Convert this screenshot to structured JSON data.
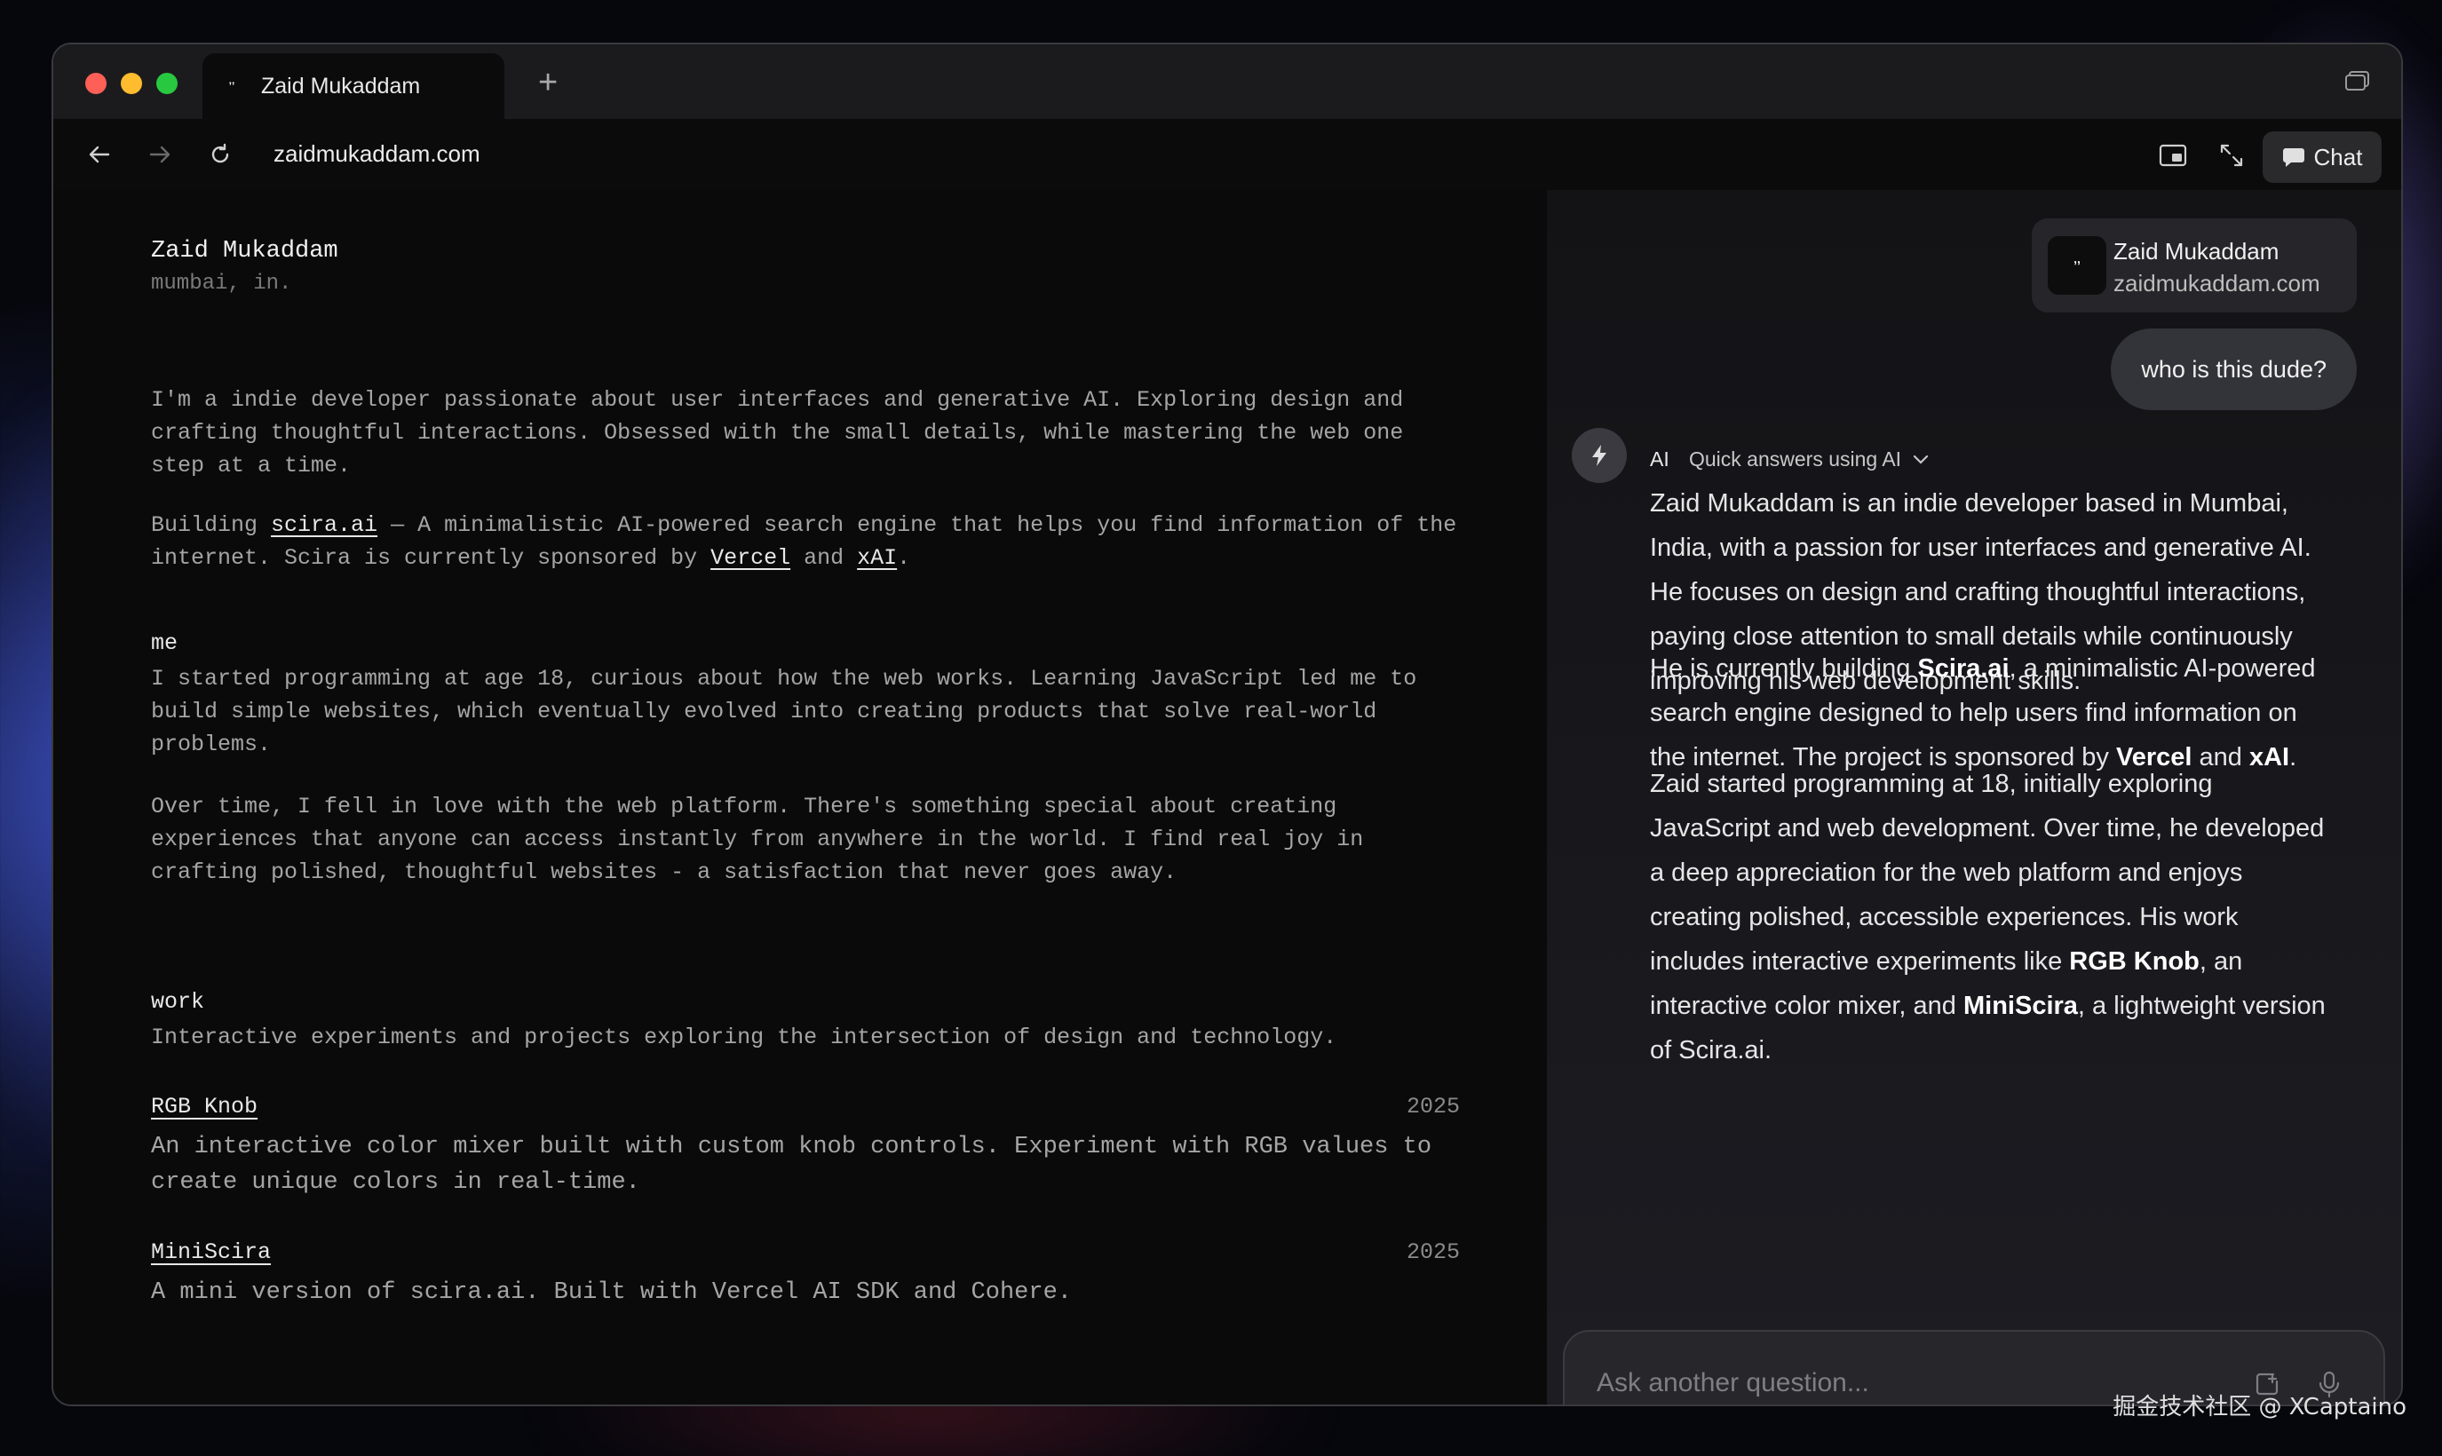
{
  "browser": {
    "tab_title": "Zaid Mukaddam",
    "favicon_text": "ʼʼ",
    "new_tab": "+",
    "url": "zaidmukaddam.com",
    "chat_label": "Chat"
  },
  "page": {
    "name": "Zaid Mukaddam",
    "location": "mumbai, in.",
    "intro": "I'm a indie developer passionate about user interfaces and generative AI. Exploring design and crafting thoughtful interactions. Obsessed with the small details, while mastering the web one step at a time.",
    "building_prefix": "Building ",
    "building_link": "scira.ai",
    "building_mid": " — A minimalistic AI-powered search engine that helps you find information of the internet. Scira is currently sponsored by ",
    "sponsor1": "Vercel",
    "and": " and ",
    "sponsor2": "xAI",
    "period": ".",
    "me_heading": "me",
    "me_p1": "I started programming at age 18, curious about how the web works. Learning JavaScript led me to build simple websites, which eventually evolved into creating products that solve real-world problems.",
    "me_p2": "Over time, I fell in love with the web platform. There's something special about creating experiences that anyone can access instantly from anywhere in the world. I find real joy in crafting polished, thoughtful websites - a satisfaction that never goes away.",
    "work_heading": "work",
    "work_desc": "Interactive experiments and projects exploring the intersection of design and technology.",
    "projects": [
      {
        "title": "RGB Knob",
        "year": "2025",
        "desc": "An interactive color mixer built with custom knob controls. Experiment with RGB values to create unique colors in real-time."
      },
      {
        "title": "MiniScira",
        "year": "2025",
        "desc": "A mini version of scira.ai. Built with Vercel AI SDK and Cohere."
      }
    ]
  },
  "chat": {
    "context_name": "Zaid Mukaddam",
    "context_url": "zaidmukaddam.com",
    "user_message": "who is this dude?",
    "ai_tag": "AI",
    "ai_mode": "Quick answers using AI",
    "answer_p1": "Zaid Mukaddam is an indie developer based in Mumbai, India, with a passion for user interfaces and generative AI. He focuses on design and crafting thoughtful interactions, paying close attention to small details while continuously improving his web development skills.",
    "answer_p2_a": "He is currently building ",
    "answer_p2_b": "Scira.ai",
    "answer_p2_c": ", a minimalistic AI-powered search engine designed to help users find information on the internet. The project is sponsored by ",
    "answer_p2_d": "Vercel",
    "answer_p2_e": " and ",
    "answer_p2_f": "xAI",
    "answer_p2_g": ".",
    "answer_p3_a": "Zaid started programming at 18, initially exploring JavaScript and web development. Over time, he developed a deep appreciation for the web platform and enjoys creating polished, accessible experiences. His work includes interactive experiments like ",
    "answer_p3_b": "RGB Knob",
    "answer_p3_c": ", an interactive color mixer, and ",
    "answer_p3_d": "MiniScira",
    "answer_p3_e": ", a lightweight version of Scira.ai.",
    "input_placeholder": "Ask another question..."
  },
  "watermark": "掘金技术社区 @ XCaptaino",
  "colors": {
    "tl_red": "#fe5f57",
    "tl_yellow": "#febc2e",
    "tl_green": "#28c840"
  }
}
